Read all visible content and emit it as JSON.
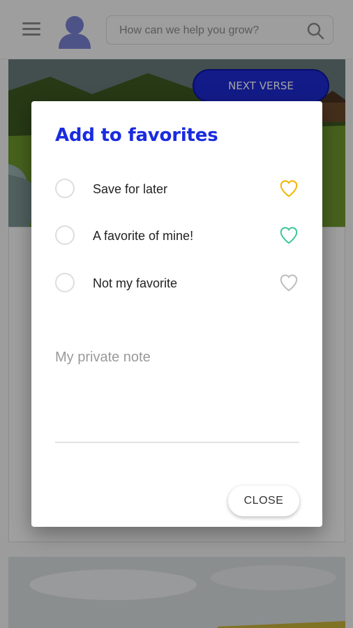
{
  "header": {
    "search_placeholder": "How can we help you grow?",
    "menu_icon": "hamburger-menu-icon",
    "avatar_icon": "user-avatar-icon",
    "search_icon": "magnifier-icon"
  },
  "hero": {
    "next_verse_label": "NEXT VERSE"
  },
  "dialog": {
    "title": "Add to favorites",
    "options": [
      {
        "label": "Save for later",
        "heart_color": "#f4b400",
        "selected": false
      },
      {
        "label": "A favorite of mine!",
        "heart_color": "#3cc79a",
        "selected": false
      },
      {
        "label": "Not my favorite",
        "heart_color": "#bdbdbd",
        "selected": false
      }
    ],
    "note_placeholder": "My private note",
    "close_label": "CLOSE"
  },
  "colors": {
    "accent": "#1a2be0",
    "button": "#1f2bd6"
  }
}
